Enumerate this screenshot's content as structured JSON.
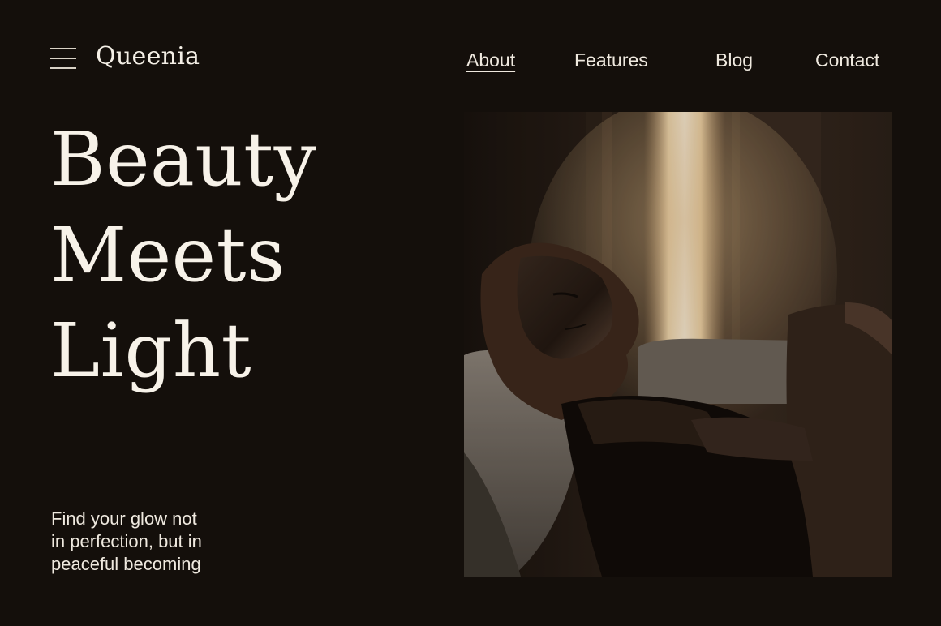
{
  "header": {
    "brand": "Queenia",
    "menu_icon": "hamburger-menu-icon",
    "nav": [
      {
        "label": "About",
        "active": true
      },
      {
        "label": "Features",
        "active": false
      },
      {
        "label": "Blog",
        "active": false
      },
      {
        "label": "Contact",
        "active": false
      }
    ]
  },
  "hero": {
    "headline_lines": [
      "Beauty",
      "Meets",
      "Light"
    ],
    "tagline_lines": [
      "Find your glow not",
      "in perfection, but in",
      "peaceful becoming"
    ],
    "photo": "woman-resting-on-sofa-in-window-light"
  },
  "colors": {
    "background": "#140f0b",
    "text": "#f4efe6"
  }
}
